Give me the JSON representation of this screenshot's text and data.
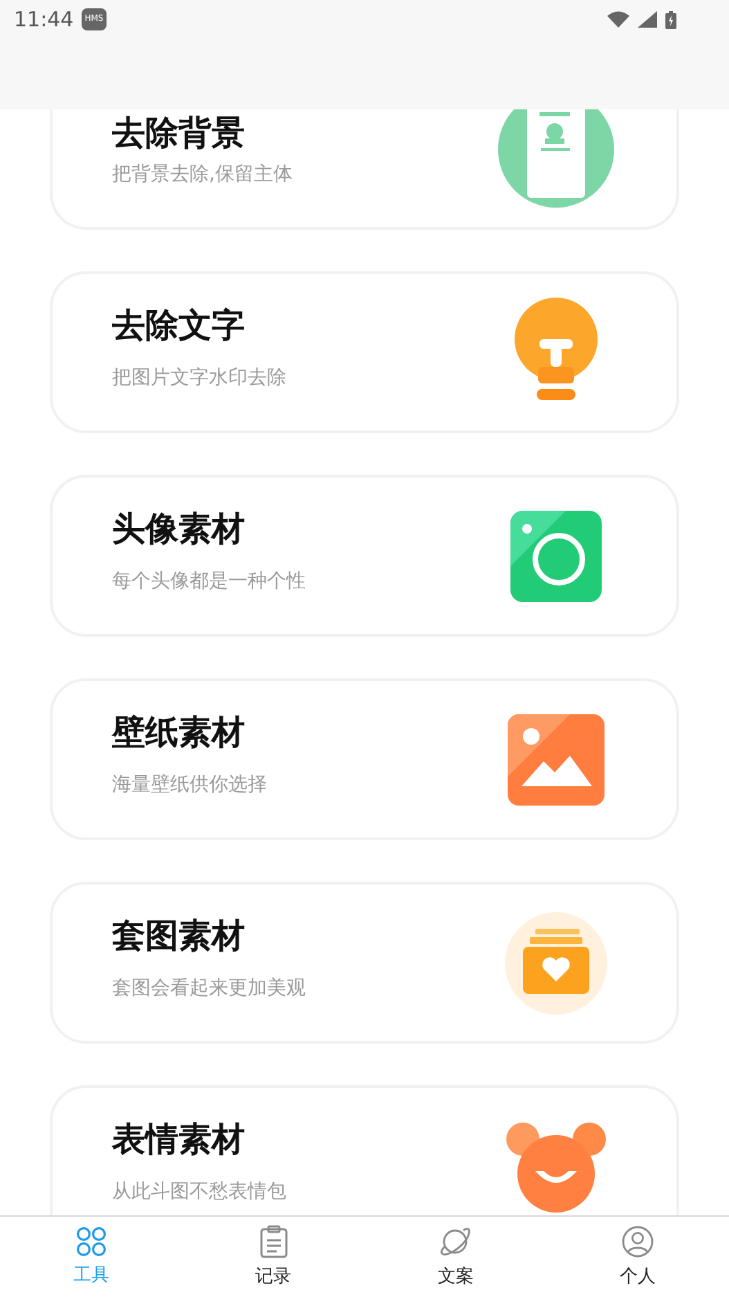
{
  "status_bar": {
    "time": "11:44",
    "badge": "HMS"
  },
  "cards": [
    {
      "title": "去除背景",
      "subtitle": "把背景去除,保留主体"
    },
    {
      "title": "去除文字",
      "subtitle": "把图片文字水印去除"
    },
    {
      "title": "头像素材",
      "subtitle": "每个头像都是一种个性"
    },
    {
      "title": "壁纸素材",
      "subtitle": "海量壁纸供你选择"
    },
    {
      "title": "套图素材",
      "subtitle": "套图会看起来更加美观"
    },
    {
      "title": "表情素材",
      "subtitle": "从此斗图不愁表情包"
    }
  ],
  "tabs": [
    {
      "label": "工具",
      "selected": true
    },
    {
      "label": "记录",
      "selected": false
    },
    {
      "label": "文案",
      "selected": false
    },
    {
      "label": "个人",
      "selected": false
    }
  ]
}
